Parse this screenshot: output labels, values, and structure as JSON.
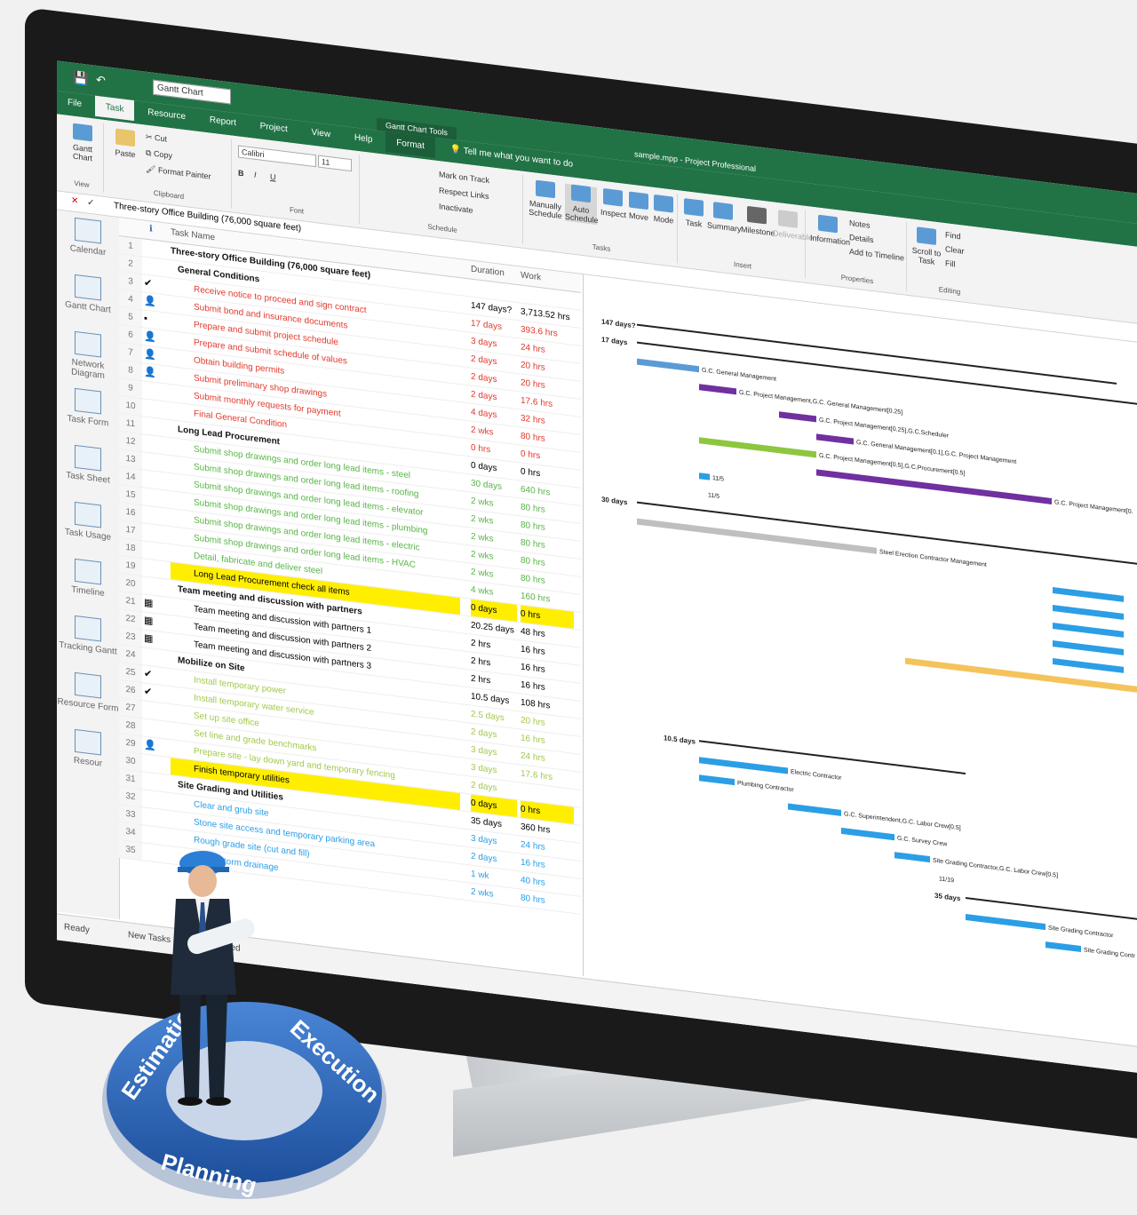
{
  "quick_access": {
    "view_select": "Gantt Chart"
  },
  "title": "sample.mpp - Project Professional",
  "contextual_tab": "Gantt Chart Tools",
  "tabs": [
    "File",
    "Task",
    "Resource",
    "Report",
    "Project",
    "View",
    "Help",
    "Format"
  ],
  "tell_me": "Tell me what you want to do",
  "ribbon": {
    "view_group": {
      "button": "Gantt Chart",
      "label": "View"
    },
    "clipboard": {
      "paste": "Paste",
      "cut": "Cut",
      "copy": "Copy",
      "format_painter": "Format Painter",
      "label": "Clipboard"
    },
    "font": {
      "family": "Calibri",
      "size": "11",
      "label": "Font"
    },
    "schedule": {
      "mark_on_track": "Mark on Track",
      "respect_links": "Respect Links",
      "inactivate": "Inactivate",
      "label": "Schedule"
    },
    "tasks": {
      "manually": "Manually Schedule",
      "auto": "Auto Schedule",
      "inspect": "Inspect",
      "move": "Move",
      "mode": "Mode",
      "label": "Tasks"
    },
    "insert": {
      "task": "Task",
      "summary": "Summary",
      "milestone": "Milestone",
      "deliverable": "Deliverable",
      "label": "Insert"
    },
    "properties": {
      "information": "Information",
      "notes": "Notes",
      "details": "Details",
      "add_to_timeline": "Add to Timeline",
      "label": "Properties"
    },
    "editing": {
      "scroll_to_task": "Scroll to Task",
      "find": "Find",
      "clear": "Clear",
      "fill": "Fill",
      "label": "Editing"
    }
  },
  "entry_bar": "Three-story Office Building (76,000 square feet)",
  "views": [
    "Calendar",
    "Gantt Chart",
    "Network Diagram",
    "Task Form",
    "Task Sheet",
    "Task Usage",
    "Timeline",
    "Tracking Gantt",
    "Resource Form",
    "Resour"
  ],
  "columns": {
    "task_name": "Task Name",
    "duration": "Duration",
    "work": "Work"
  },
  "rows": [
    {
      "n": "1",
      "name": "Three-story Office Building (76,000 square feet)",
      "dur": "",
      "work": "",
      "style": "summary",
      "ind": ""
    },
    {
      "n": "2",
      "name": "General Conditions",
      "dur": "147 days?",
      "work": "3,713.52 hrs",
      "style": "summary",
      "ind": ""
    },
    {
      "n": "3",
      "name": "Receive notice to proceed and sign contract",
      "dur": "17 days",
      "work": "393.6 hrs",
      "style": "red",
      "ind": "✔"
    },
    {
      "n": "4",
      "name": "Submit bond and insurance documents",
      "dur": "3 days",
      "work": "24 hrs",
      "style": "red",
      "ind": "👤"
    },
    {
      "n": "5",
      "name": "Prepare and submit project schedule",
      "dur": "2 days",
      "work": "20 hrs",
      "style": "red",
      "ind": "▪"
    },
    {
      "n": "6",
      "name": "Prepare and submit schedule of values",
      "dur": "2 days",
      "work": "20 hrs",
      "style": "red",
      "ind": "👤"
    },
    {
      "n": "7",
      "name": "Obtain building permits",
      "dur": "2 days",
      "work": "17.6 hrs",
      "style": "red",
      "ind": "👤"
    },
    {
      "n": "8",
      "name": "Submit preliminary shop drawings",
      "dur": "4 days",
      "work": "32 hrs",
      "style": "red",
      "ind": "👤"
    },
    {
      "n": "9",
      "name": "Submit monthly requests for payment",
      "dur": "2 wks",
      "work": "80 hrs",
      "style": "red",
      "ind": ""
    },
    {
      "n": "10",
      "name": "Final General Condition",
      "dur": "0 hrs",
      "work": "0 hrs",
      "style": "red",
      "ind": ""
    },
    {
      "n": "11",
      "name": "Long Lead Procurement",
      "dur": "0 days",
      "work": "0 hrs",
      "style": "summary",
      "ind": ""
    },
    {
      "n": "12",
      "name": "Submit shop drawings and order long lead items - steel",
      "dur": "30 days",
      "work": "640 hrs",
      "style": "green",
      "ind": ""
    },
    {
      "n": "13",
      "name": "Submit shop drawings and order long lead items - roofing",
      "dur": "2 wks",
      "work": "80 hrs",
      "style": "green",
      "ind": ""
    },
    {
      "n": "14",
      "name": "Submit shop drawings and order long lead items - elevator",
      "dur": "2 wks",
      "work": "80 hrs",
      "style": "green",
      "ind": ""
    },
    {
      "n": "15",
      "name": "Submit shop drawings and order long lead items - plumbing",
      "dur": "2 wks",
      "work": "80 hrs",
      "style": "green",
      "ind": ""
    },
    {
      "n": "16",
      "name": "Submit shop drawings and order long lead items - electric",
      "dur": "2 wks",
      "work": "80 hrs",
      "style": "green",
      "ind": ""
    },
    {
      "n": "17",
      "name": "Submit shop drawings and order long lead items - HVAC",
      "dur": "2 wks",
      "work": "80 hrs",
      "style": "green",
      "ind": ""
    },
    {
      "n": "18",
      "name": "Detail, fabricate and deliver steel",
      "dur": "4 wks",
      "work": "160 hrs",
      "style": "green",
      "ind": ""
    },
    {
      "n": "19",
      "name": "Long Lead Procurement check all items",
      "dur": "0 days",
      "work": "0 hrs",
      "style": "hl",
      "ind": ""
    },
    {
      "n": "20",
      "name": "Team meeting and discussion with partners",
      "dur": "20.25 days",
      "work": "48 hrs",
      "style": "summary",
      "ind": ""
    },
    {
      "n": "21",
      "name": "Team meeting and discussion with partners 1",
      "dur": "2 hrs",
      "work": "16 hrs",
      "style": "plain",
      "ind": "▦"
    },
    {
      "n": "22",
      "name": "Team meeting and discussion with partners 2",
      "dur": "2 hrs",
      "work": "16 hrs",
      "style": "plain",
      "ind": "▦"
    },
    {
      "n": "23",
      "name": "Team meeting and discussion with partners 3",
      "dur": "2 hrs",
      "work": "16 hrs",
      "style": "plain",
      "ind": "▦"
    },
    {
      "n": "24",
      "name": "Mobilize on Site",
      "dur": "10.5 days",
      "work": "108 hrs",
      "style": "summary",
      "ind": ""
    },
    {
      "n": "25",
      "name": "Install temporary power",
      "dur": "2.5 days",
      "work": "20 hrs",
      "style": "olive",
      "ind": "✔"
    },
    {
      "n": "26",
      "name": "Install temporary water service",
      "dur": "2 days",
      "work": "16 hrs",
      "style": "olive",
      "ind": "✔"
    },
    {
      "n": "27",
      "name": "Set up site office",
      "dur": "3 days",
      "work": "24 hrs",
      "style": "olive",
      "ind": ""
    },
    {
      "n": "28",
      "name": "Set line and grade benchmarks",
      "dur": "3 days",
      "work": "17.6 hrs",
      "style": "olive",
      "ind": ""
    },
    {
      "n": "29",
      "name": "Prepare site - lay down yard and temporary fencing",
      "dur": "2 days",
      "work": "",
      "style": "olive",
      "ind": "👤"
    },
    {
      "n": "30",
      "name": "Finish temporary utilities",
      "dur": "0 days",
      "work": "0 hrs",
      "style": "hl",
      "ind": ""
    },
    {
      "n": "31",
      "name": "Site Grading and Utilities",
      "dur": "35 days",
      "work": "360 hrs",
      "style": "summary",
      "ind": ""
    },
    {
      "n": "32",
      "name": "Clear and grub site",
      "dur": "3 days",
      "work": "24 hrs",
      "style": "blue",
      "ind": ""
    },
    {
      "n": "33",
      "name": "Stone site access and temporary parking area",
      "dur": "2 days",
      "work": "16 hrs",
      "style": "blue",
      "ind": ""
    },
    {
      "n": "34",
      "name": "Rough grade site (cut and fill)",
      "dur": "1 wk",
      "work": "40 hrs",
      "style": "blue",
      "ind": ""
    },
    {
      "n": "35",
      "name": "Install storm drainage",
      "dur": "2 wks",
      "work": "80 hrs",
      "style": "blue",
      "ind": ""
    }
  ],
  "gantt": {
    "summary_labels": [
      "147 days?",
      "17 days",
      "30 days",
      "10.5 days",
      "35 days"
    ],
    "bar_labels": [
      "G.C. General Management",
      "G.C. Project Management,G.C. General Management[0.25]",
      "G.C. Project Management[0.25],G.C.Scheduler",
      "G.C. General Management[0.1],G.C. Project Management",
      "G.C. Project Management[0.5],G.C.Procurement[0.5]",
      "G.C. Project Management[0.",
      "11/5",
      "Steel Erection Contractor Management",
      "Electric Contractor",
      "Plumbing Contractor",
      "G.C. Superintendent,G.C. Labor Crew[0.5]",
      "G.C. Survey Crew",
      "Site Grading Contractor,G.C. Labor Crew[0.5]",
      "11/19",
      "Site Grading Contractor",
      "Site Grading Contr"
    ]
  },
  "status": {
    "ready": "Ready",
    "new_tasks": "New Tasks : Auto Scheduled"
  },
  "badge": {
    "ring_words": [
      "Estimation",
      "Execution",
      "Planning"
    ]
  },
  "colors": {
    "ribbon_green": "#217346",
    "red_task": "#e23a2e",
    "green_task": "#59b548",
    "highlight": "#ffee00",
    "bar_blue": "#2b9ee6",
    "bar_purple": "#7030a0"
  }
}
